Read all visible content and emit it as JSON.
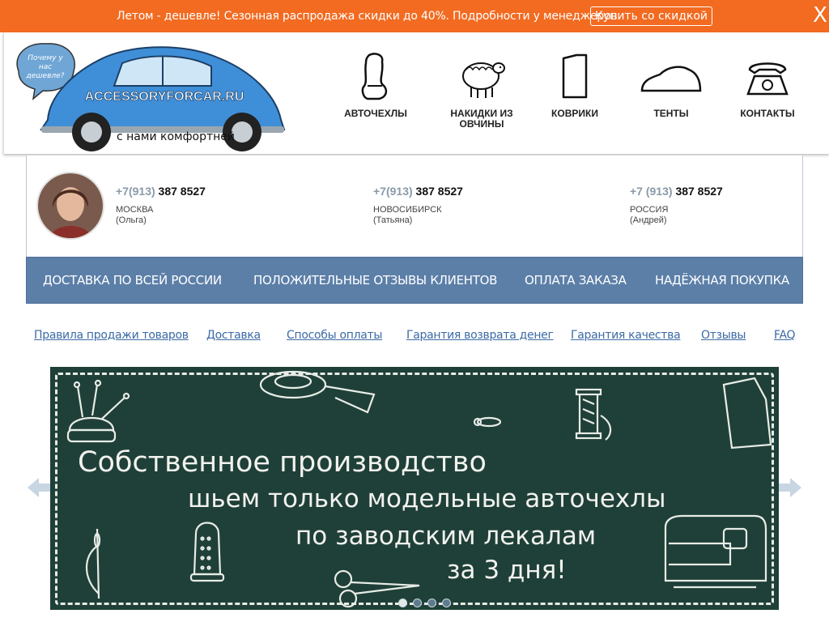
{
  "promo": {
    "text": "Летом - дешевле! Сезонная распродажа скидки до 40%. Подробности у менеджеров.",
    "button": "Купить со скидкой",
    "close": "X"
  },
  "logo": {
    "bubble": [
      "Почему у",
      "нас",
      "дешевле?"
    ],
    "site": "ACCESSORYFORCAR.RU",
    "tagline": "с нами комфортней"
  },
  "nav": {
    "items": [
      {
        "label": "АВТОЧЕХЛЫ",
        "icon": "seat-cover-icon"
      },
      {
        "label": "НАКИДКИ ИЗ ОВЧИНЫ",
        "icon": "sheep-icon"
      },
      {
        "label": "КОВРИКИ",
        "icon": "floor-mat-icon"
      },
      {
        "label": "ТЕНТЫ",
        "icon": "car-tent-icon"
      },
      {
        "label": "КОНТАКТЫ",
        "icon": "phone-icon"
      }
    ]
  },
  "contacts": [
    {
      "code": "+7(913)",
      "number": "387 8527",
      "city": "МОСКВА",
      "person": "(Ольга)"
    },
    {
      "code": "+7(913)",
      "number": "387 8527",
      "city": "НОВОСИБИРСК",
      "person": "(Татьяна)"
    },
    {
      "code": "+7 (913)",
      "number": "387 8527",
      "city": "РОССИЯ",
      "person": "(Андрей)"
    }
  ],
  "menu": [
    "ДОСТАВКА ПО ВСЕЙ РОССИИ",
    "ПОЛОЖИТЕЛЬНЫЕ ОТЗЫВЫ КЛИЕНТОВ",
    "ОПЛАТА ЗАКАЗА",
    "НАДЁЖНАЯ ПОКУПКА"
  ],
  "links": [
    "Правила продажи товаров",
    "Доставка",
    "Способы оплаты",
    "Гарантия возврата денег",
    "Гарантия качества",
    "Отзывы",
    "FAQ"
  ],
  "banner": {
    "lines": [
      "Собственное производство",
      "шьем только модельные авточехлы",
      "по заводским лекалам",
      "за 3 дня!"
    ],
    "slides": 4,
    "active_slide": 0
  },
  "colors": {
    "promo_bg": "#f26b21",
    "menu_bg": "#5c7fa8",
    "link": "#3b6aa5",
    "banner_bg": "#1f4038"
  }
}
